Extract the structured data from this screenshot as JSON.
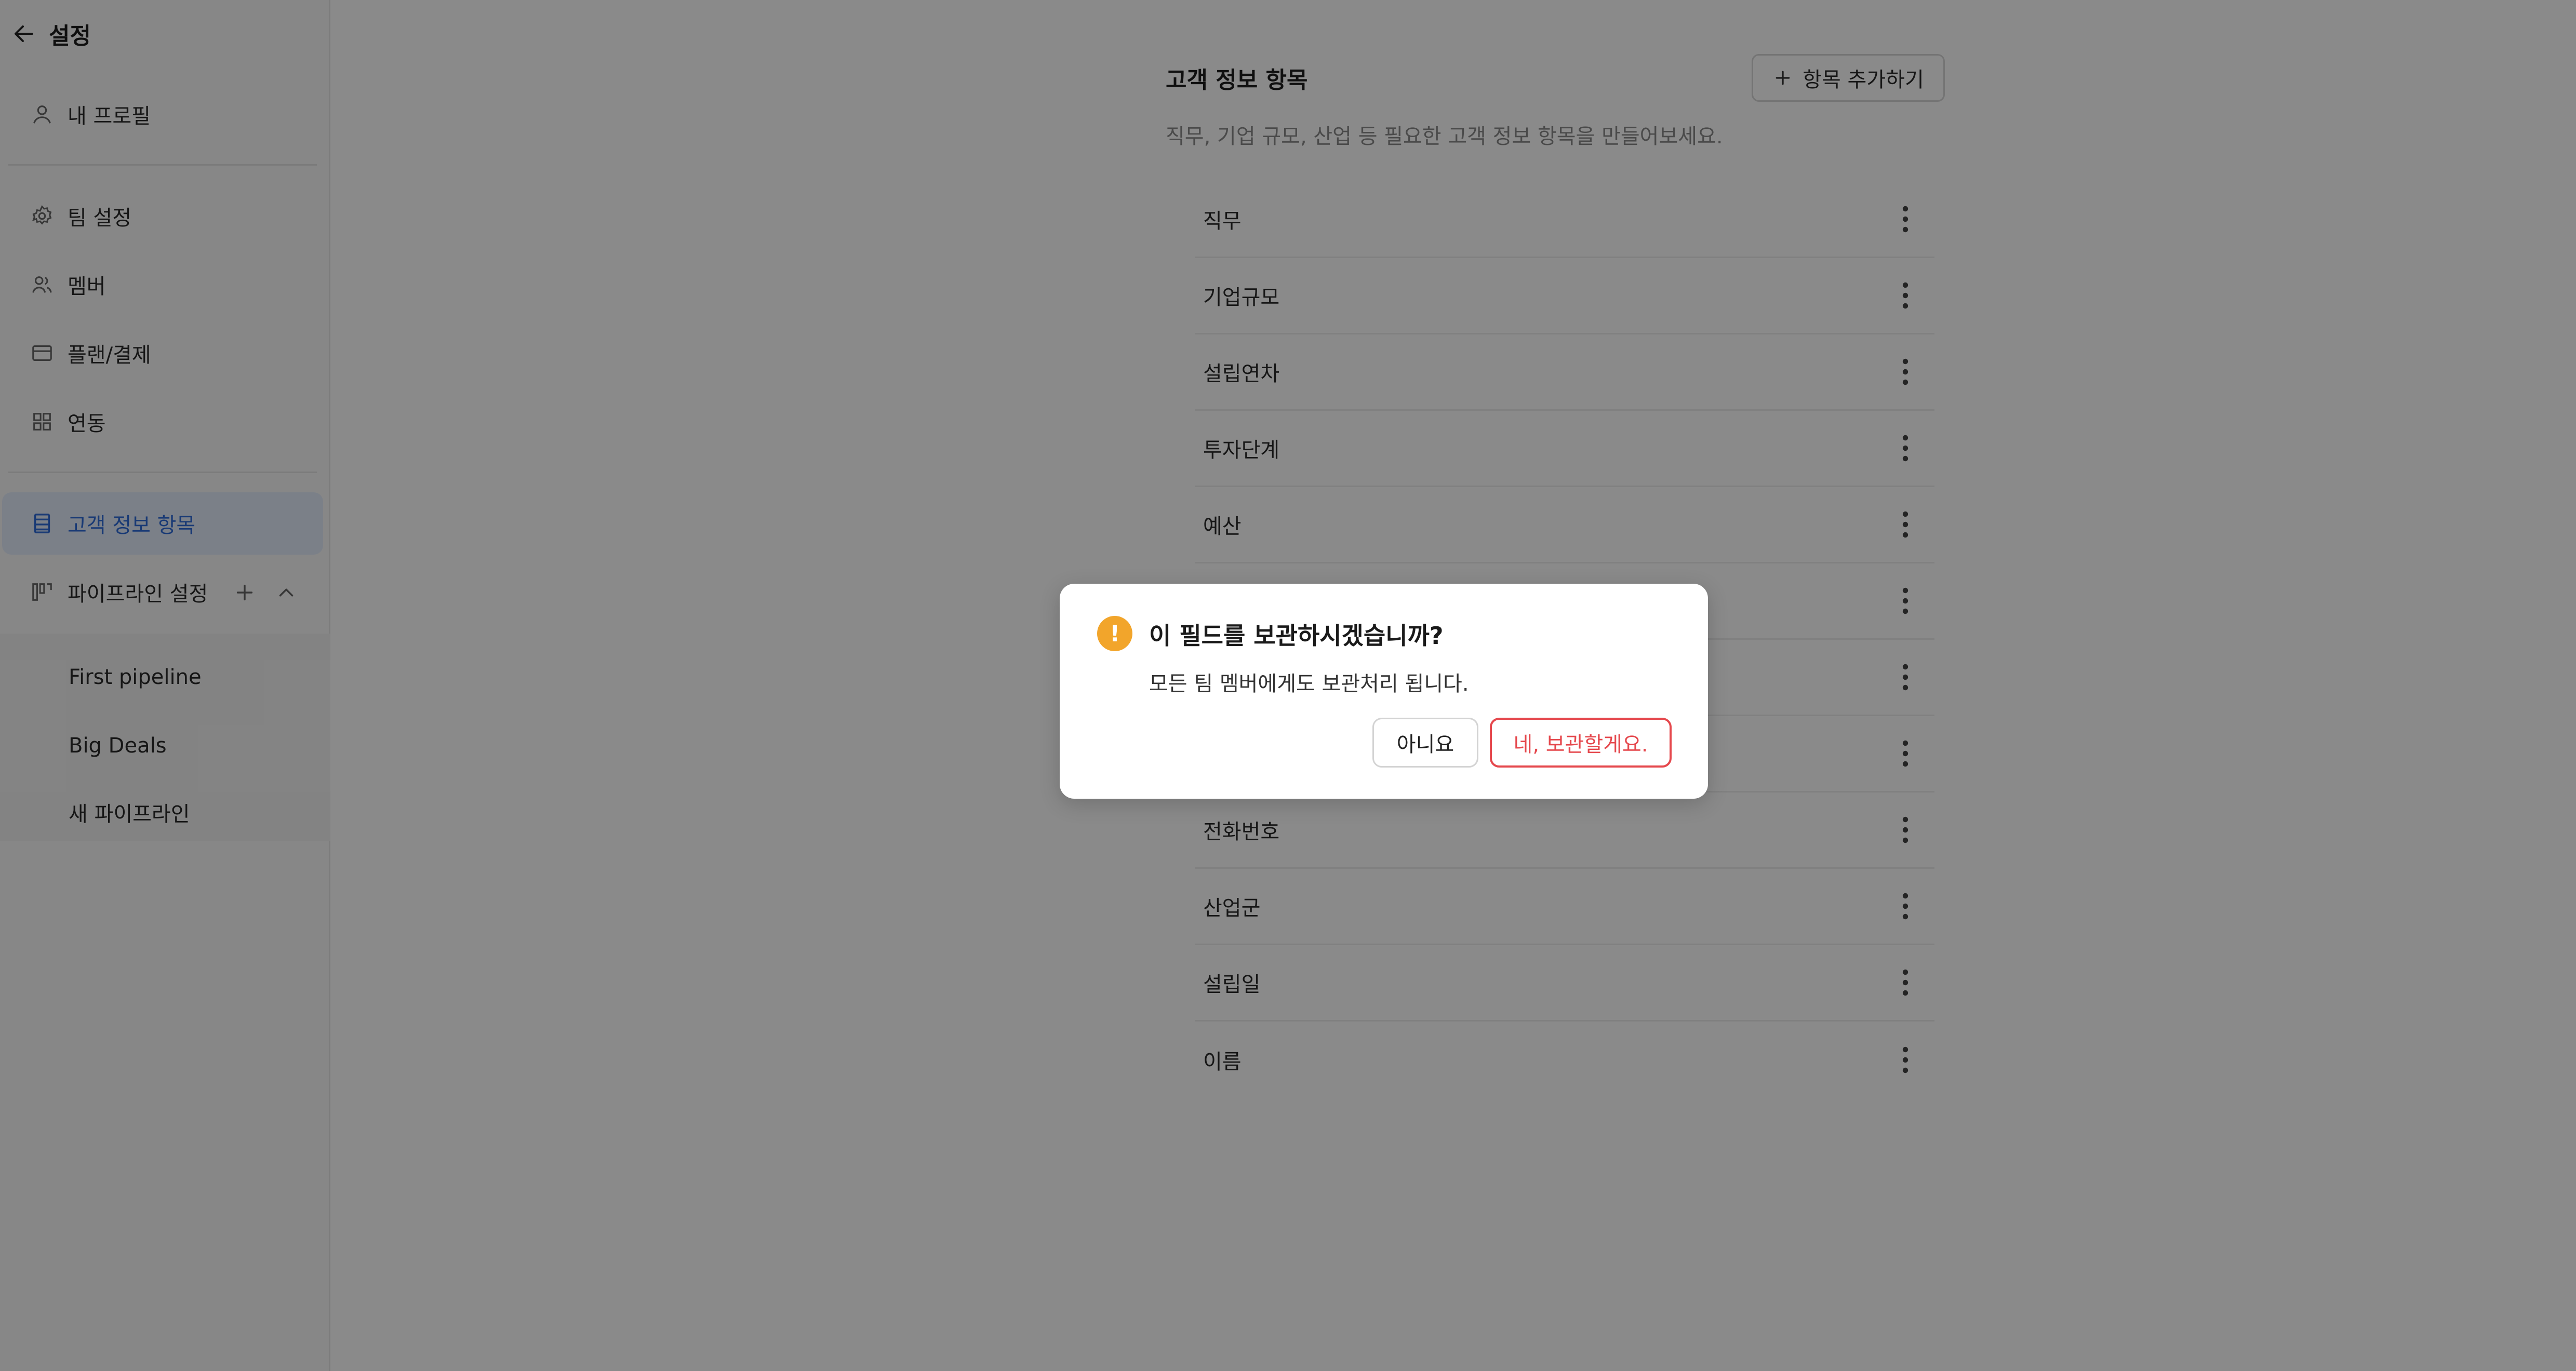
{
  "sidebar": {
    "title": "설정",
    "profile": "내 프로필",
    "team_settings": "팀 설정",
    "members": "멤버",
    "plan_billing": "플랜/결제",
    "integrations": "연동",
    "customer_fields": "고객 정보 항목",
    "pipeline_settings": "파이프라인 설정",
    "pipelines": [
      "First pipeline",
      "Big Deals",
      "새 파이프라인"
    ]
  },
  "main": {
    "title": "고객 정보 항목",
    "add_button": "항목 추가하기",
    "description": "직무, 기업 규모, 산업 등 필요한 고객 정보 항목을 만들어보세요.",
    "fields": [
      "직무",
      "기업규모",
      "설립연차",
      "투자단계",
      "예산",
      "",
      "",
      "",
      "전화번호",
      "산업군",
      "설립일",
      "이름"
    ]
  },
  "dialog": {
    "title": "이 필드를 보관하시겠습니까?",
    "body": "모든 팀 멤버에게도 보관처리 됩니다.",
    "cancel": "아니요",
    "confirm": "네, 보관할게요."
  },
  "colors": {
    "accent": "#2f6cd9",
    "danger": "#e5484d",
    "warning": "#f2a52b"
  }
}
